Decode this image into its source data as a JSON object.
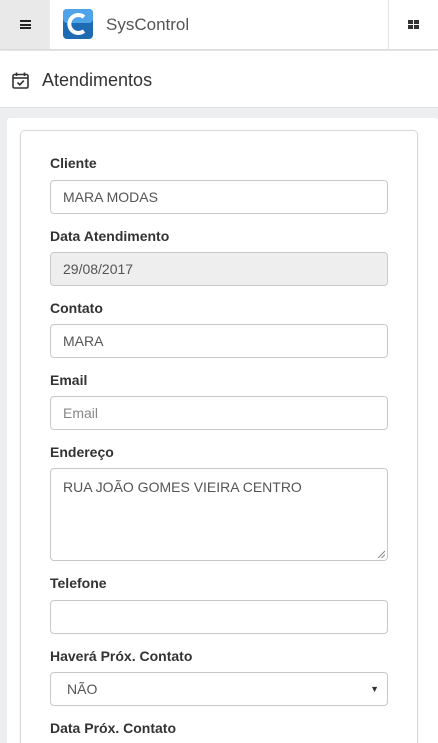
{
  "app": {
    "brand": "SysControl"
  },
  "header": {
    "title": "Atendimentos"
  },
  "form": {
    "cliente": {
      "label": "Cliente",
      "value": "MARA MODAS"
    },
    "data_atendimento": {
      "label": "Data Atendimento",
      "value": "29/08/2017"
    },
    "contato": {
      "label": "Contato",
      "value": "MARA"
    },
    "email": {
      "label": "Email",
      "value": "",
      "placeholder": "Email"
    },
    "endereco": {
      "label": "Endereço",
      "value": "RUA JOÃO GOMES VIEIRA CENTRO"
    },
    "telefone": {
      "label": "Telefone",
      "value": ""
    },
    "havera_prox_contato": {
      "label": "Haverá Próx. Contato",
      "value": "NÃO"
    },
    "data_prox_contato": {
      "label": "Data Próx. Contato"
    }
  },
  "icons": {
    "menu": "hamburger-icon",
    "logo": "app-logo",
    "apps": "grid-icon",
    "page": "calendar-check-icon",
    "select": "caret-down-icon"
  },
  "colors": {
    "logo_blue": "#1f6bb3",
    "disabled_bg": "#eeeeee",
    "topbar_menu_bg": "#e9e9e9"
  }
}
